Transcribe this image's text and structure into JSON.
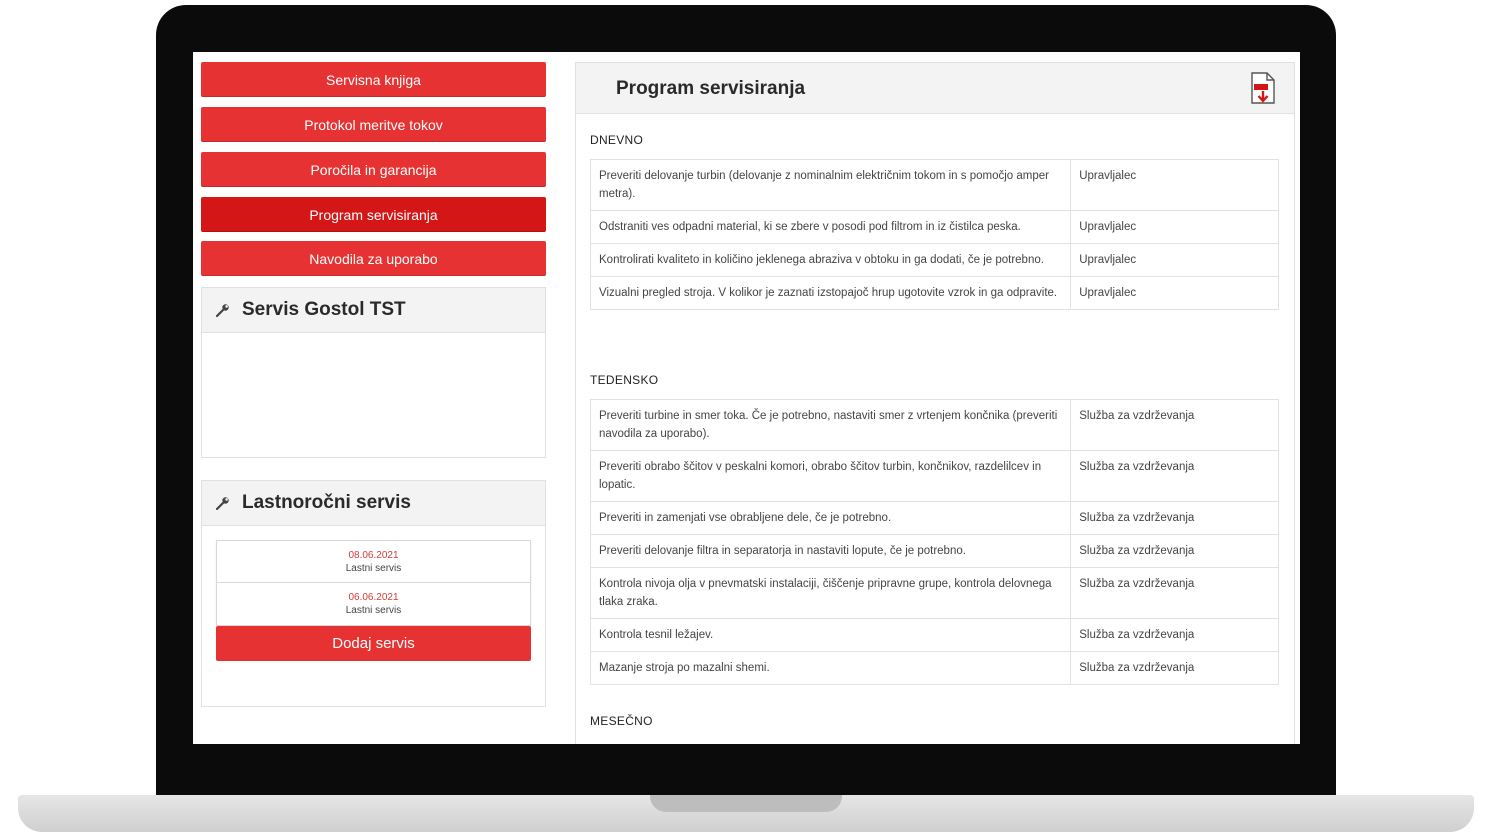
{
  "sidebar": {
    "nav": [
      {
        "label": "Servisna knjiga"
      },
      {
        "label": "Protokol meritve tokov"
      },
      {
        "label": "Poročila in garancija"
      },
      {
        "label": "Program servisiranja",
        "active": true
      },
      {
        "label": "Navodila za uporabo"
      }
    ],
    "device_panel": {
      "title": "Servis Gostol TST"
    },
    "self_service": {
      "title": "Lastnoročni servis",
      "entries": [
        {
          "date": "08.06.2021",
          "type": "Lastni servis"
        },
        {
          "date": "06.06.2021",
          "type": "Lastni servis"
        }
      ],
      "add_label": "Dodaj servis"
    }
  },
  "main": {
    "title": "Program servisiranja",
    "sections": [
      {
        "label": "DNEVNO",
        "rows": [
          {
            "task": "Preveriti delovanje turbin (delovanje z nominalnim električnim tokom in s pomočjo amper metra).",
            "responsible": "Upravljalec"
          },
          {
            "task": "Odstraniti ves odpadni material, ki se zbere v posodi pod filtrom in iz čistilca peska.",
            "responsible": "Upravljalec"
          },
          {
            "task": "Kontrolirati kvaliteto in količino jeklenega abraziva v obtoku in ga dodati, če je potrebno.",
            "responsible": "Upravljalec"
          },
          {
            "task": "Vizualni pregled stroja. V kolikor je zaznati izstopajoč hrup ugotovite vzrok in ga odpravite.",
            "responsible": "Upravljalec"
          }
        ]
      },
      {
        "label": "TEDENSKO",
        "rows": [
          {
            "task": "Preveriti turbine in smer toka. Če je potrebno, nastaviti smer z vrtenjem končnika (preveriti navodila za uporabo).",
            "responsible": "Služba za vzdrževanja"
          },
          {
            "task": "Preveriti obrabo ščitov v peskalni komori, obrabo ščitov turbin, končnikov, razdelilcev in lopatic.",
            "responsible": "Služba za vzdrževanja"
          },
          {
            "task": "Preveriti in zamenjati vse obrabljene dele, če je potrebno.",
            "responsible": "Služba za vzdrževanja"
          },
          {
            "task": "Preveriti delovanje filtra in separatorja in nastaviti lopute, če je potrebno.",
            "responsible": "Služba za vzdrževanja"
          },
          {
            "task": "Kontrola nivoja olja v pnevmatski instalaciji, čiščenje pripravne grupe, kontrola delovnega tlaka zraka.",
            "responsible": "Služba za vzdrževanja"
          },
          {
            "task": "Kontrola tesnil ležajev.",
            "responsible": "Služba za vzdrževanja"
          },
          {
            "task": "Mazanje stroja po mazalni shemi.",
            "responsible": "Služba za vzdrževanja"
          }
        ]
      },
      {
        "label": "MESEČNO",
        "rows": []
      }
    ]
  },
  "icons": {
    "panel": "wrench-icon",
    "export": "pdf-download-icon"
  },
  "colors": {
    "accent": "#e63232",
    "accent_active": "#d41616",
    "panel_header": "#f3f3f3"
  }
}
